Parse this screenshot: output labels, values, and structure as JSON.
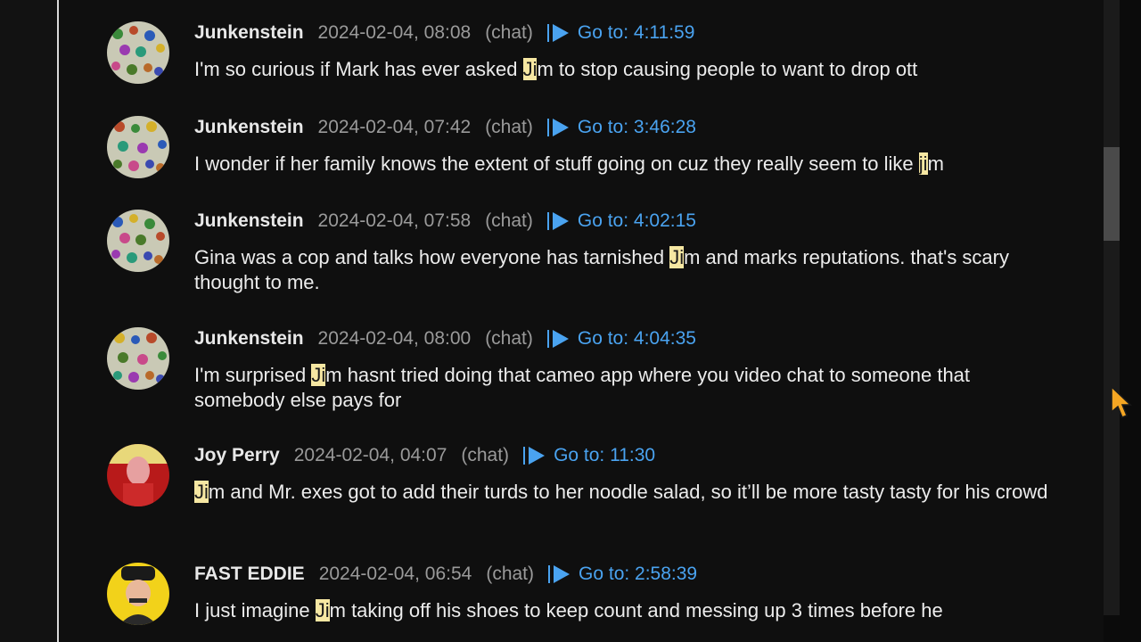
{
  "messages": [
    {
      "author": "Junkenstein",
      "date": "2024-02-04, 08:08",
      "source": "(chat)",
      "goto": "Go to: 4:11:59",
      "text_pre": "I'm so curious if Mark has ever asked ",
      "highlight": "Ji",
      "text_post": "m to stop causing people to want to drop ott",
      "avatar": "mosaic-avatar"
    },
    {
      "author": "Junkenstein",
      "date": "2024-02-04, 07:42",
      "source": "(chat)",
      "goto": "Go to: 3:46:28",
      "text_pre": "I wonder if her family knows the extent of stuff going on cuz they really seem to like ",
      "highlight": "ji",
      "text_post": "m",
      "avatar": "mosaic-avatar"
    },
    {
      "author": "Junkenstein",
      "date": "2024-02-04, 07:58",
      "source": "(chat)",
      "goto": "Go to: 4:02:15",
      "text_pre": "Gina was a cop and talks how everyone has tarnished ",
      "highlight": "Ji",
      "text_post": "m and marks reputations. that's scary thought to me.",
      "avatar": "mosaic-avatar"
    },
    {
      "author": "Junkenstein",
      "date": "2024-02-04, 08:00",
      "source": "(chat)",
      "goto": "Go to: 4:04:35",
      "text_pre": "I'm surprised ",
      "highlight": "Ji",
      "text_post": "m hasnt tried doing that cameo app where you video chat to someone that somebody else pays for",
      "avatar": "mosaic-avatar"
    },
    {
      "author": "Joy Perry",
      "date": "2024-02-04, 04:07",
      "source": "(chat)",
      "goto": "Go to: 11:30",
      "text_pre": "",
      "highlight": "Ji",
      "text_post": "m and Mr. exes got to add their turds to her noodle salad, so it’ll be more tasty tasty for his crowd",
      "avatar": "red-avatar"
    },
    {
      "author": "FAST EDDIE",
      "date": "2024-02-04, 06:54",
      "source": "(chat)",
      "goto": "Go to: 2:58:39",
      "text_pre": "I just imagine ",
      "highlight": "Ji",
      "text_post": "m taking off his shoes to keep count and messing up 3 times before he",
      "avatar": "yellow-avatar"
    }
  ],
  "colors": {
    "accent": "#4aa3f0",
    "highlight": "#f6e7a2",
    "text": "#ececec",
    "muted": "#9a9a9a"
  },
  "icons": [
    "play-icon",
    "mouse-cursor-icon"
  ]
}
